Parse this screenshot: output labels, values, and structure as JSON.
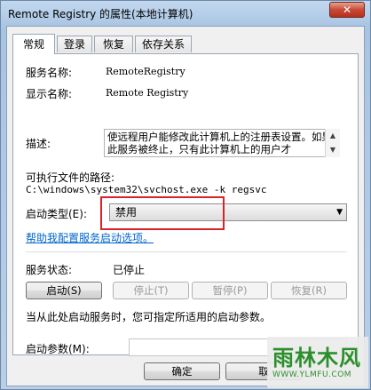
{
  "window": {
    "title": "Remote Registry 的属性(本地计算机)",
    "close_label": "✕"
  },
  "tabs": [
    {
      "label": "常规"
    },
    {
      "label": "登录"
    },
    {
      "label": "恢复"
    },
    {
      "label": "依存关系"
    }
  ],
  "general": {
    "service_name_label": "服务名称:",
    "service_name_value": "RemoteRegistry",
    "display_name_label": "显示名称:",
    "display_name_value": "Remote Registry",
    "description_label": "描述:",
    "description_text": "使远程用户能修改此计算机上的注册表设置。如果此服务被终止，只有此计算机上的用户才",
    "exe_path_label": "可执行文件的路径:",
    "exe_path_value": "C:\\windows\\system32\\svchost.exe -k regsvc",
    "startup_type_label": "启动类型(E):",
    "startup_type_value": "禁用",
    "help_link": "帮助我配置服务启动选项。",
    "status_label": "服务状态:",
    "status_value": "已停止",
    "start_button": "启动(S)",
    "stop_button": "停止(T)",
    "pause_button": "暂停(P)",
    "resume_button": "恢复(R)",
    "hint_text": "当从此处启动服务时，您可指定所适用的启动参数。",
    "start_params_label": "启动参数(M):",
    "start_params_value": ""
  },
  "footer": {
    "ok_button": "确定",
    "cancel_button": "取"
  },
  "watermark": {
    "logo_text": "雨林木风",
    "url_text": "WWW.YLMFU.COM"
  },
  "colors": {
    "highlight_box": "#d8232a",
    "link": "#0066cc",
    "watermark": "#2c8f2c"
  }
}
